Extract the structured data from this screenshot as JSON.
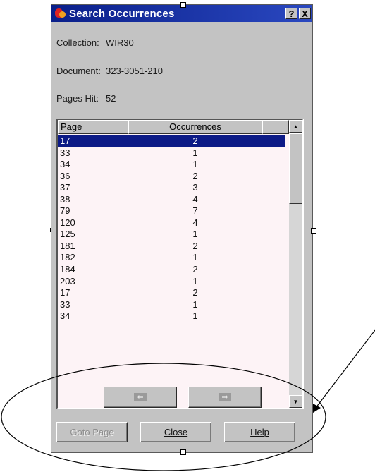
{
  "dialog": {
    "title": "Search Occurrences",
    "help_button": "?",
    "close_button": "X"
  },
  "info": {
    "collection_label": "Collection:",
    "collection_value": "WIR30",
    "document_label": "Document:",
    "document_value": "323-3051-210",
    "pages_hit_label": "Pages Hit:",
    "pages_hit_value": "52"
  },
  "list": {
    "columns": [
      "Page",
      "Occurrences"
    ],
    "rows": [
      {
        "page": "17",
        "occurrences": "2"
      },
      {
        "page": "33",
        "occurrences": "1"
      },
      {
        "page": "34",
        "occurrences": "1"
      },
      {
        "page": "36",
        "occurrences": "2"
      },
      {
        "page": "37",
        "occurrences": "3"
      },
      {
        "page": "38",
        "occurrences": "4"
      },
      {
        "page": "79",
        "occurrences": "7"
      },
      {
        "page": "120",
        "occurrences": "4"
      },
      {
        "page": "125",
        "occurrences": "1"
      },
      {
        "page": "181",
        "occurrences": "2"
      },
      {
        "page": "182",
        "occurrences": "1"
      },
      {
        "page": "184",
        "occurrences": "2"
      },
      {
        "page": "203",
        "occurrences": "1"
      },
      {
        "page": "17",
        "occurrences": "2"
      },
      {
        "page": "33",
        "occurrences": "1"
      },
      {
        "page": "34",
        "occurrences": "1"
      }
    ],
    "selected_index": 0
  },
  "nav": {
    "prev_icon": "left-arrow-icon",
    "next_icon": "right-arrow-icon"
  },
  "buttons": {
    "goto_page": "Goto Page",
    "close": "Close",
    "help": "Help"
  },
  "colors": {
    "title_bar": "#0a1f8a",
    "selection": "#0c1a86",
    "dialog_face": "#c3c3c3"
  }
}
